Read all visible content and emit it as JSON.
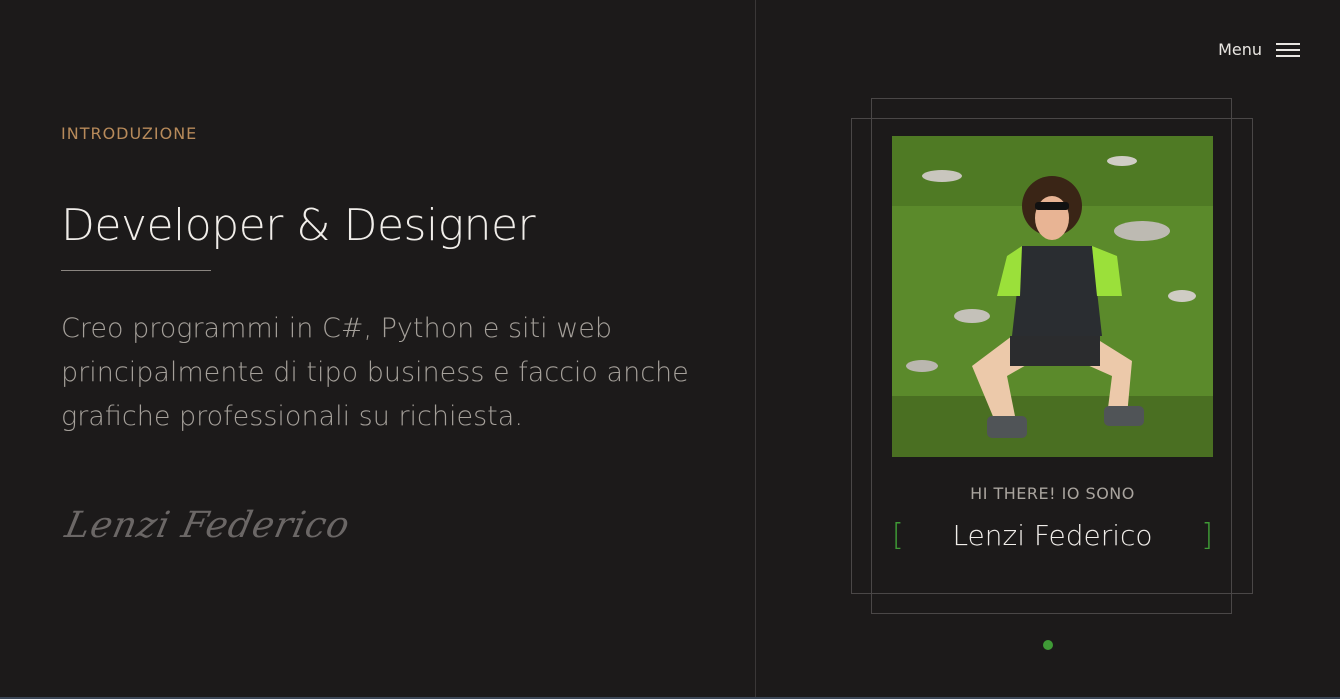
{
  "nav": {
    "menu_label": "Menu",
    "menu_icon": "hamburger-icon"
  },
  "intro": {
    "eyebrow": "INTRODUZIONE",
    "headline": "Developer & Designer",
    "description": "Creo programmi in C#, Python e siti web principalmente di tipo business e faccio anche grafiche professionali su richiesta.",
    "signature": "Lenzi Federico"
  },
  "profile": {
    "greeting": "HI THERE! IO SONO",
    "name": "Lenzi Federico",
    "bracket_open": "[",
    "bracket_close": "]"
  },
  "colors": {
    "background": "#1c1a1a",
    "accent_gold": "#b78a5a",
    "accent_green": "#3f9a36"
  }
}
